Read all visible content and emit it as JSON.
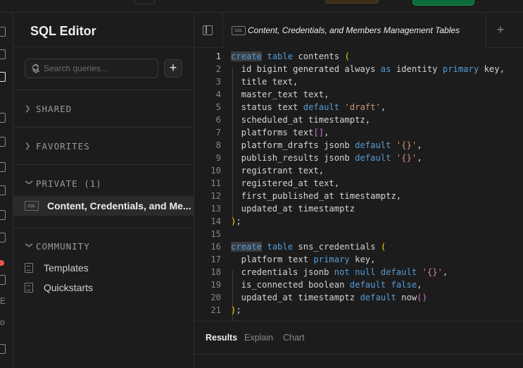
{
  "sidebar": {
    "title": "SQL Editor",
    "search_placeholder": "Search queries...",
    "add_label": "+",
    "sections": {
      "shared": "SHARED",
      "favorites": "FAVORITES",
      "private": "PRIVATE (1)",
      "community": "COMMUNITY"
    },
    "private_item": "Content, Credentials, and Me...",
    "sql_badge": "SQL",
    "community_items": [
      "Templates",
      "Quickstarts"
    ]
  },
  "tab": {
    "label": "Content, Credentials, and Members Management Tables",
    "badge": "SQL",
    "new_tab": "+"
  },
  "editor": {
    "current_line": 1,
    "lines": [
      [
        {
          "t": "create",
          "c": "kwsel"
        },
        {
          "t": " "
        },
        {
          "t": "table",
          "c": "kw"
        },
        {
          "t": " contents "
        },
        {
          "t": "(",
          "c": "par"
        }
      ],
      [
        {
          "t": "  id bigint generated always "
        },
        {
          "t": "as",
          "c": "kw"
        },
        {
          "t": " identity "
        },
        {
          "t": "primary",
          "c": "kw"
        },
        {
          "t": " key,"
        }
      ],
      [
        {
          "t": "  title text,"
        }
      ],
      [
        {
          "t": "  master_text text,"
        }
      ],
      [
        {
          "t": "  status text "
        },
        {
          "t": "default",
          "c": "kw"
        },
        {
          "t": " "
        },
        {
          "t": "'draft'",
          "c": "str"
        },
        {
          "t": ","
        }
      ],
      [
        {
          "t": "  scheduled_at timestamptz,"
        }
      ],
      [
        {
          "t": "  platforms text"
        },
        {
          "t": "[]",
          "c": "brk"
        },
        {
          "t": ","
        }
      ],
      [
        {
          "t": "  platform_drafts jsonb "
        },
        {
          "t": "default",
          "c": "kw"
        },
        {
          "t": " "
        },
        {
          "t": "'{}'",
          "c": "str"
        },
        {
          "t": ","
        }
      ],
      [
        {
          "t": "  publish_results jsonb "
        },
        {
          "t": "default",
          "c": "kw"
        },
        {
          "t": " "
        },
        {
          "t": "'{}'",
          "c": "str"
        },
        {
          "t": ","
        }
      ],
      [
        {
          "t": "  registrant text,"
        }
      ],
      [
        {
          "t": "  registered_at text,"
        }
      ],
      [
        {
          "t": "  first_published_at timestamptz,"
        }
      ],
      [
        {
          "t": "  updated_at timestamptz"
        }
      ],
      [
        {
          "t": ")",
          "c": "par"
        },
        {
          "t": ";"
        }
      ],
      [],
      [
        {
          "t": "create",
          "c": "kwsel"
        },
        {
          "t": " "
        },
        {
          "t": "table",
          "c": "kw"
        },
        {
          "t": " sns_credentials "
        },
        {
          "t": "(",
          "c": "par"
        }
      ],
      [
        {
          "t": "  platform text "
        },
        {
          "t": "primary",
          "c": "kw"
        },
        {
          "t": " key,"
        }
      ],
      [
        {
          "t": "  credentials jsonb "
        },
        {
          "t": "not null",
          "c": "kw"
        },
        {
          "t": " "
        },
        {
          "t": "default",
          "c": "kw"
        },
        {
          "t": " "
        },
        {
          "t": "'{}'",
          "c": "str"
        },
        {
          "t": ","
        }
      ],
      [
        {
          "t": "  is_connected boolean "
        },
        {
          "t": "default",
          "c": "kw"
        },
        {
          "t": " "
        },
        {
          "t": "false",
          "c": "kw"
        },
        {
          "t": ","
        }
      ],
      [
        {
          "t": "  updated_at timestamptz "
        },
        {
          "t": "default",
          "c": "kw"
        },
        {
          "t": " now"
        },
        {
          "t": "()",
          "c": "brk"
        }
      ],
      [
        {
          "t": ")",
          "c": "par"
        },
        {
          "t": ";"
        }
      ]
    ]
  },
  "results_tabs": [
    "Results",
    "Explain",
    "Chart"
  ],
  "rail_text": [
    "E",
    "o"
  ],
  "colors": {
    "background": "#1c1c1c",
    "keyword": "#569cd6",
    "string": "#ce9178",
    "paren": "#ffd700",
    "bracket": "#da70d6",
    "active_item_bg": "#2a2a2a",
    "cta_green": "#0b6b3a"
  }
}
